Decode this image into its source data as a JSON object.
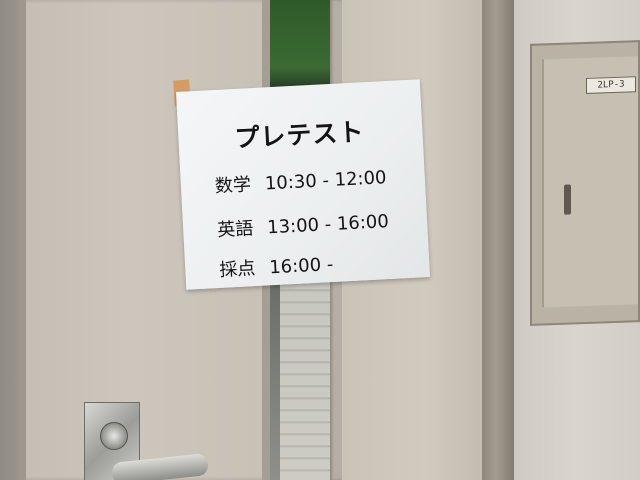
{
  "panel": {
    "label": "2LP-3"
  },
  "sign": {
    "title": "プレテスト",
    "rows": [
      {
        "label": "数学",
        "time": "10:30 - 12:00"
      },
      {
        "label": "英語",
        "time": "13:00 - 16:00"
      },
      {
        "label": "採点",
        "time": "16:00 -"
      }
    ]
  }
}
